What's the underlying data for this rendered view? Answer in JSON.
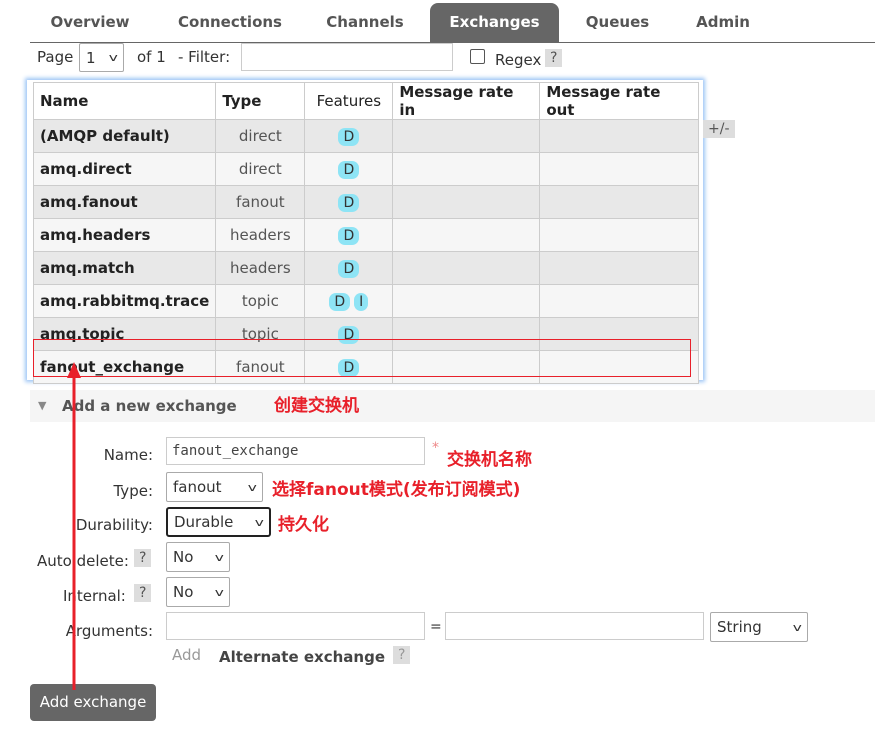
{
  "tabs": [
    {
      "label": "Overview"
    },
    {
      "label": "Connections"
    },
    {
      "label": "Channels"
    },
    {
      "label": "Exchanges",
      "active": true
    },
    {
      "label": "Queues"
    },
    {
      "label": "Admin"
    }
  ],
  "pager": {
    "page_label": "Page",
    "page_value": "1",
    "of_label": "of 1",
    "filter_label": "- Filter:",
    "filter_value": "",
    "regex_label": "Regex",
    "help": "?"
  },
  "table": {
    "headers": [
      "Name",
      "Type",
      "Features",
      "Message rate in",
      "Message rate out"
    ],
    "rows": [
      {
        "name": "(AMQP default)",
        "type": "direct",
        "features": [
          "D"
        ]
      },
      {
        "name": "amq.direct",
        "type": "direct",
        "features": [
          "D"
        ]
      },
      {
        "name": "amq.fanout",
        "type": "fanout",
        "features": [
          "D"
        ]
      },
      {
        "name": "amq.headers",
        "type": "headers",
        "features": [
          "D"
        ]
      },
      {
        "name": "amq.match",
        "type": "headers",
        "features": [
          "D"
        ]
      },
      {
        "name": "amq.rabbitmq.trace",
        "type": "topic",
        "features": [
          "D",
          "I"
        ]
      },
      {
        "name": "amq.topic",
        "type": "topic",
        "features": [
          "D"
        ]
      },
      {
        "name": "fanout_exchange",
        "type": "fanout",
        "features": [
          "D"
        ]
      }
    ],
    "columns_toggle": "+/-"
  },
  "add_section": {
    "title": "Add a new exchange",
    "name_label": "Name:",
    "name_value": "fanout_exchange",
    "required": "*",
    "type_label": "Type:",
    "type_value": "fanout",
    "durability_label": "Durability:",
    "durability_value": "Durable",
    "autodelete_label": "Auto delete:",
    "autodelete_value": "No",
    "internal_label": "Internal:",
    "internal_value": "No",
    "arguments_label": "Arguments:",
    "arg_key": "",
    "equals": "=",
    "arg_value": "",
    "arg_type": "String",
    "add_link": "Add",
    "alternate_label": "Alternate exchange",
    "help": "?",
    "submit": "Add exchange"
  },
  "annotations": {
    "create": "创建交换机",
    "name": "交换机名称",
    "type": "选择fanout模式(发布订阅模式)",
    "durability": "持久化",
    "color": "#e8202a"
  }
}
